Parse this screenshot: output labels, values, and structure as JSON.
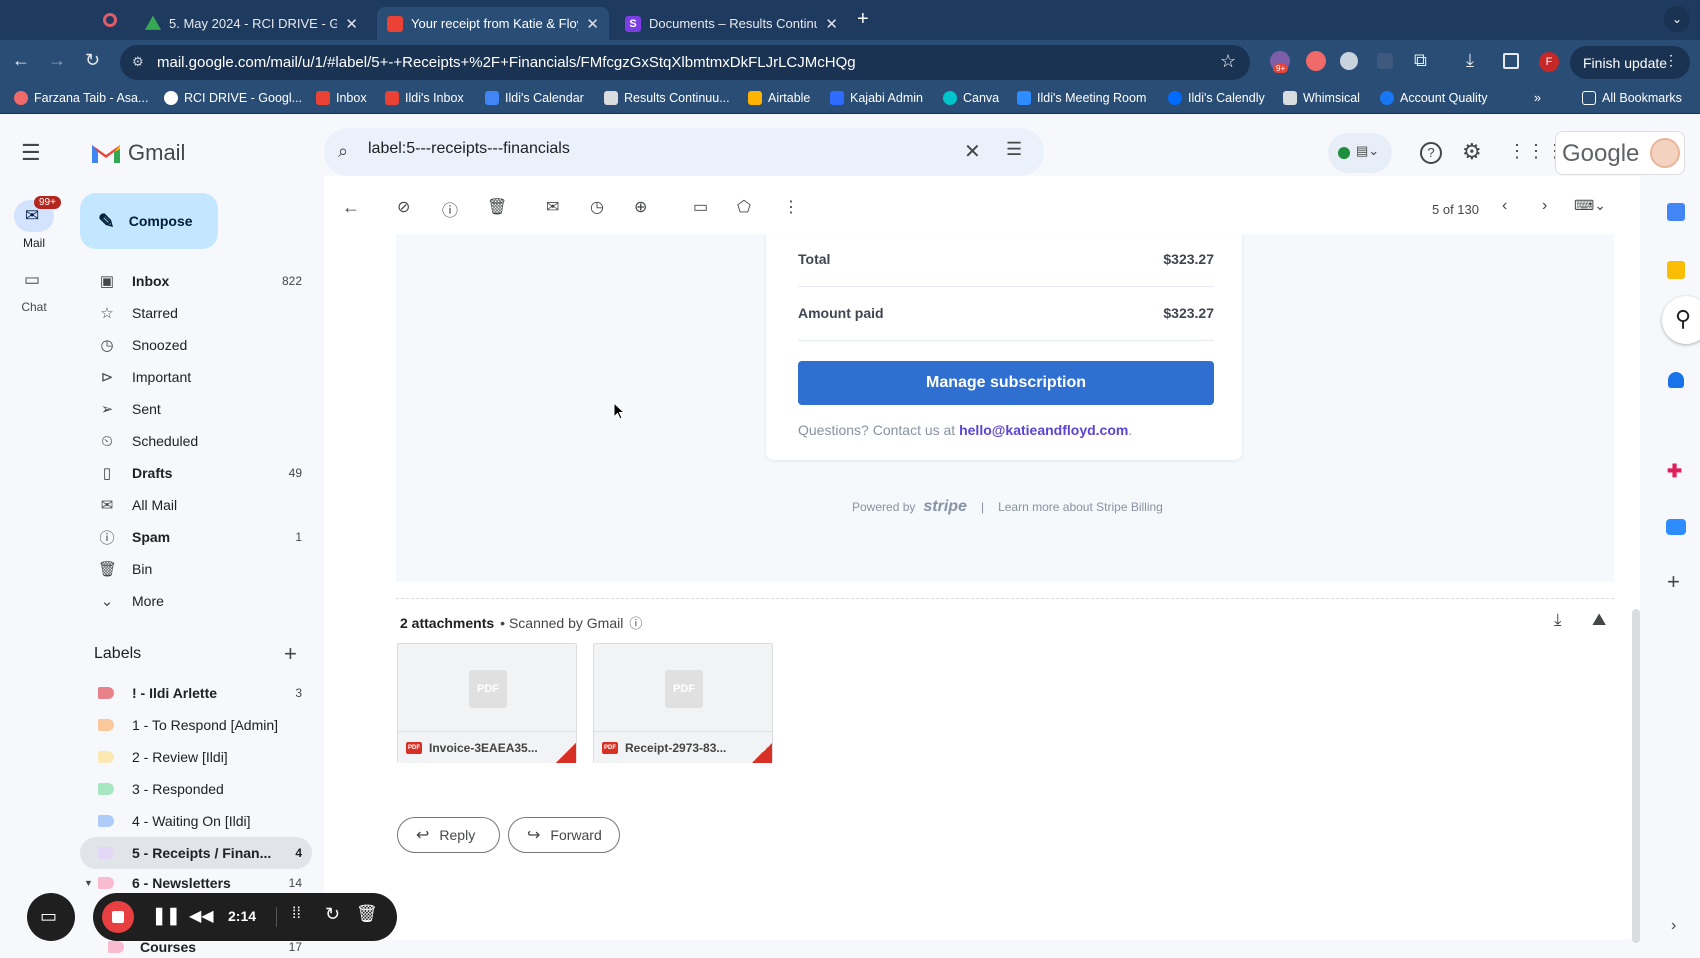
{
  "tabs": [
    {
      "title": "5. May 2024 - RCI DRIVE - Go",
      "active": false,
      "color": "#34a853"
    },
    {
      "title": "Your receipt from Katie & Floyd",
      "active": true,
      "color": "#ea4335"
    },
    {
      "title": "Documents – Results Continuum",
      "active": false,
      "color": "#7b3fe4"
    }
  ],
  "url": "mail.google.com/mail/u/1/#label/5+-+Receipts+%2F+Financials/FMfcgzGxStqXlbmtmxDkFLJrLCJMcHQg",
  "finish_update": "Finish update",
  "ext_badge": "9+",
  "profile_initial": "F",
  "bookmarks": [
    {
      "label": "Farzana Taib - Asa...",
      "color": "#f06a6a"
    },
    {
      "label": "RCI DRIVE - Googl...",
      "color": "#ffffff"
    },
    {
      "label": "Inbox",
      "color": "#ea4335"
    },
    {
      "label": "Ildi's Inbox",
      "color": "#ea4335"
    },
    {
      "label": "Ildi's Calendar",
      "color": "#4285f4"
    },
    {
      "label": "Results Continuu...",
      "color": "#dadce0"
    },
    {
      "label": "Airtable",
      "color": "#fcb400"
    },
    {
      "label": "Kajabi Admin",
      "color": "#2e6bff"
    },
    {
      "label": "Canva",
      "color": "#00c4cc"
    },
    {
      "label": "Ildi's Meeting Room",
      "color": "#2d8cff"
    },
    {
      "label": "Ildi's Calendly",
      "color": "#006bff"
    },
    {
      "label": "Whimsical",
      "color": "#dadce0"
    },
    {
      "label": "Account Quality",
      "color": "#1877f2"
    }
  ],
  "all_bookmarks": "All Bookmarks",
  "gmail": {
    "brand": "Gmail",
    "search_value": "label:5---receipts---financials",
    "google_word": "Google",
    "compose": "Compose",
    "rail": [
      {
        "label": "Mail",
        "badge": "99+"
      },
      {
        "label": "Chat"
      }
    ],
    "nav": [
      {
        "label": "Inbox",
        "count": "822",
        "bold": true,
        "icon": "inbox-icon"
      },
      {
        "label": "Starred",
        "count": "",
        "bold": false,
        "icon": "star-icon"
      },
      {
        "label": "Snoozed",
        "count": "",
        "bold": false,
        "icon": "clock-icon"
      },
      {
        "label": "Important",
        "count": "",
        "bold": false,
        "icon": "important-icon"
      },
      {
        "label": "Sent",
        "count": "",
        "bold": false,
        "icon": "send-icon"
      },
      {
        "label": "Scheduled",
        "count": "",
        "bold": false,
        "icon": "scheduled-icon"
      },
      {
        "label": "Drafts",
        "count": "49",
        "bold": true,
        "icon": "draft-icon"
      },
      {
        "label": "All Mail",
        "count": "",
        "bold": false,
        "icon": "all-mail-icon"
      },
      {
        "label": "Spam",
        "count": "1",
        "bold": true,
        "icon": "spam-icon"
      },
      {
        "label": "Bin",
        "count": "",
        "bold": false,
        "icon": "trash-icon"
      },
      {
        "label": "More",
        "count": "",
        "bold": false,
        "icon": "chevron-down-icon"
      }
    ],
    "labels_heading": "Labels",
    "labels": [
      {
        "label": "! - Ildi Arlette",
        "count": "3",
        "bold": true,
        "color": "#e8828a"
      },
      {
        "label": "1 - To Respond [Admin]",
        "count": "",
        "bold": false,
        "color": "#f9c89b"
      },
      {
        "label": "2 - Review [Ildi]",
        "count": "",
        "bold": false,
        "color": "#fce8b2"
      },
      {
        "label": "3 - Responded",
        "count": "",
        "bold": false,
        "color": "#a8e6c1"
      },
      {
        "label": "4 - Waiting On [Ildi]",
        "count": "",
        "bold": false,
        "color": "#aecbfa"
      },
      {
        "label": "5 - Receipts / Finan...",
        "count": "4",
        "bold": true,
        "color": "#e4d7f5"
      },
      {
        "label": "6 - Newsletters",
        "count": "14",
        "bold": true,
        "color": "#f8bbd0"
      },
      {
        "label": "Courses",
        "count": "17",
        "bold": true,
        "color": "#f8bbd0"
      }
    ],
    "pagination": "5 of 130"
  },
  "receipt": {
    "total_label": "Total",
    "total_value": "$323.27",
    "paid_label": "Amount paid",
    "paid_value": "$323.27",
    "manage_button": "Manage subscription",
    "questions_text": "Questions? Contact us at",
    "contact_email": "hello@katieandfloyd.com",
    "period": ".",
    "powered_by": "Powered by",
    "stripe": "stripe",
    "separator": "|",
    "learn_more": "Learn more about Stripe Billing"
  },
  "attachments": {
    "count_text": "2 attachments",
    "scanned": "• Scanned by Gmail",
    "files": [
      {
        "name": "Invoice-3EAEA35...",
        "badge": "PDF"
      },
      {
        "name": "Receipt-2973-83...",
        "badge": "PDF"
      }
    ]
  },
  "reply": "Reply",
  "forward": "Forward",
  "recorder": {
    "time": "2:14"
  },
  "colors": {
    "accent": "#2f6fcf",
    "link": "#5b43d6",
    "stripe_gray": "#6b7280"
  }
}
